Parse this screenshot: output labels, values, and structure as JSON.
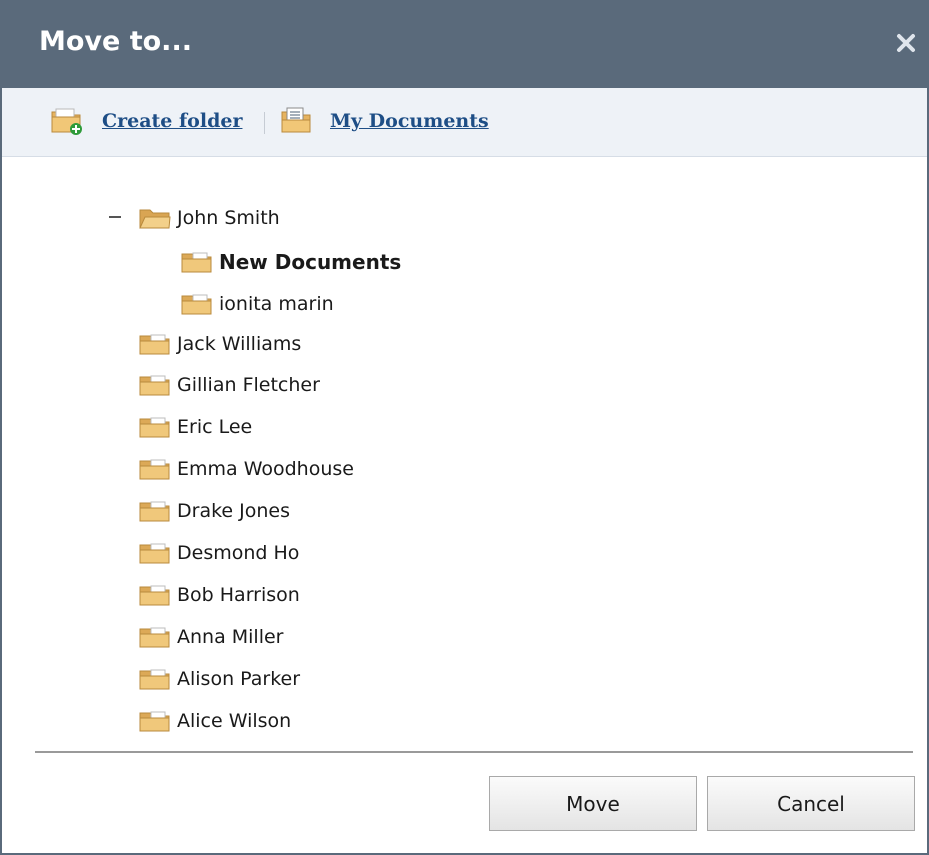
{
  "dialog": {
    "title": "Move to...",
    "close_icon": "close-icon"
  },
  "toolbar": {
    "create_folder_label": "Create folder",
    "create_folder_icon": "folder-add-icon",
    "my_documents_label": "My Documents",
    "my_documents_icon": "documents-folder-icon"
  },
  "tree": {
    "root": {
      "label": "John Smith",
      "expanded": true,
      "children": [
        {
          "label": "New Documents",
          "selected": true
        },
        {
          "label": "ionita marin"
        }
      ]
    },
    "items": [
      {
        "label": "Jack Williams"
      },
      {
        "label": "Gillian Fletcher"
      },
      {
        "label": "Eric Lee"
      },
      {
        "label": "Emma Woodhouse"
      },
      {
        "label": "Drake Jones"
      },
      {
        "label": "Desmond Ho"
      },
      {
        "label": "Bob Harrison"
      },
      {
        "label": "Anna Miller"
      },
      {
        "label": "Alison Parker"
      },
      {
        "label": "Alice Wilson"
      }
    ]
  },
  "buttons": {
    "move_label": "Move",
    "cancel_label": "Cancel"
  },
  "colors": {
    "titlebar": "#5a6a7b",
    "toolbar_bg": "#eef2f7",
    "link": "#1e4e86",
    "folder": "#e8b867"
  }
}
